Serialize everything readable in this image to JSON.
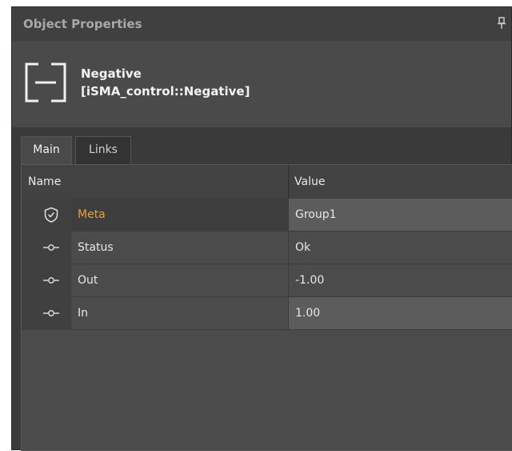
{
  "panel": {
    "title": "Object Properties",
    "pin_icon": "pin-icon"
  },
  "object": {
    "name": "Negative",
    "type": "[iSMA_control::Negative]",
    "icon": "negative-block-icon"
  },
  "tabs": [
    {
      "label": "Main",
      "active": true
    },
    {
      "label": "Links",
      "active": false
    }
  ],
  "grid": {
    "columns": {
      "name": "Name",
      "value": "Value"
    },
    "rows": [
      {
        "icon": "shield-check-icon",
        "name": "Meta",
        "value": "Group1"
      },
      {
        "icon": "slot-icon",
        "name": "Status",
        "value": "Ok"
      },
      {
        "icon": "slot-icon",
        "name": "Out",
        "value": "-1.00"
      },
      {
        "icon": "slot-icon",
        "name": "In",
        "value": "1.00"
      }
    ]
  },
  "colors": {
    "meta_label": "#e6a23c",
    "panel_bg": "#3a3a3a",
    "text": "#e8e8e8"
  }
}
